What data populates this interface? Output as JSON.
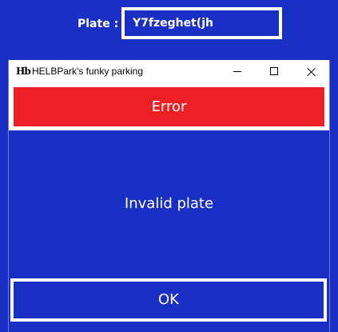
{
  "background_form": {
    "plate_label": "Plate :",
    "plate_value": "Y7fzeghet(jh"
  },
  "dialog": {
    "title": "HELBPark's funky parking",
    "icon": "helbpark-app-icon",
    "header": "Error",
    "message": "Invalid plate",
    "ok_label": "OK",
    "window_buttons": [
      "minimize-icon",
      "maximize-icon",
      "close-icon"
    ]
  },
  "colors": {
    "background": "#1a2fc4",
    "error_banner": "#ee2026",
    "text": "#ffffff",
    "titlebar": "#ffffff"
  }
}
